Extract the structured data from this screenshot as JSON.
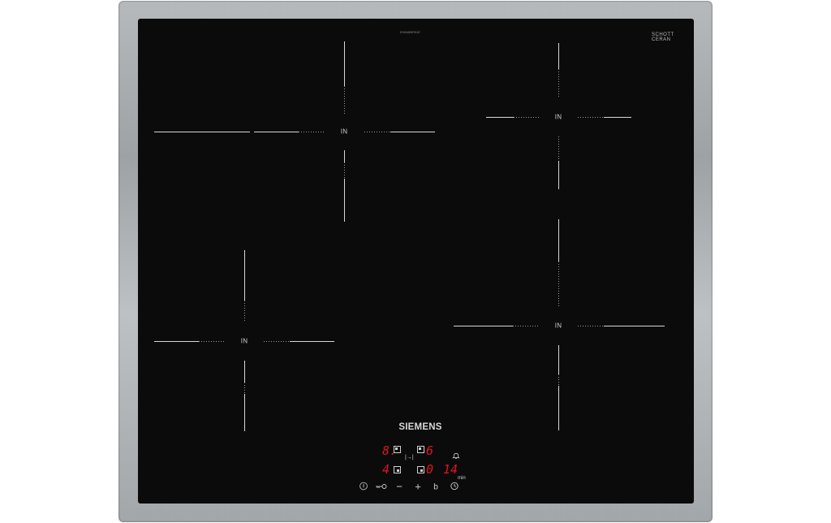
{
  "product": {
    "brand": "SIEMENS",
    "glass_brand_line1": "SCHOTT",
    "glass_brand_line2": "CERAN",
    "model_code": "EH645BFB1E",
    "frame": "stainless steel",
    "surface": "black ceramic glass"
  },
  "zones": [
    {
      "id": "front-left-top",
      "label": "IN"
    },
    {
      "id": "right-top",
      "label": "IN"
    },
    {
      "id": "left-bottom",
      "label": "IN"
    },
    {
      "id": "right-bottom",
      "label": "IN"
    }
  ],
  "display": {
    "zone_top_left_level": "8.",
    "zone_top_right_level": "6",
    "zone_bottom_left_level": "4",
    "zone_bottom_right_level": "0",
    "timer_value": "14",
    "timer_unit": "min"
  },
  "controls": {
    "power_symbol": "power-icon",
    "lock_symbol": "key-icon",
    "minus_symbol": "−",
    "plus_symbol": "+",
    "boost_symbol": "b",
    "timer_symbol": "clock-icon",
    "alarm_symbol": "bell-icon"
  },
  "colors": {
    "display": "#e0141e",
    "glass": "#0b0b0b",
    "markings": "#d8d8d8"
  }
}
